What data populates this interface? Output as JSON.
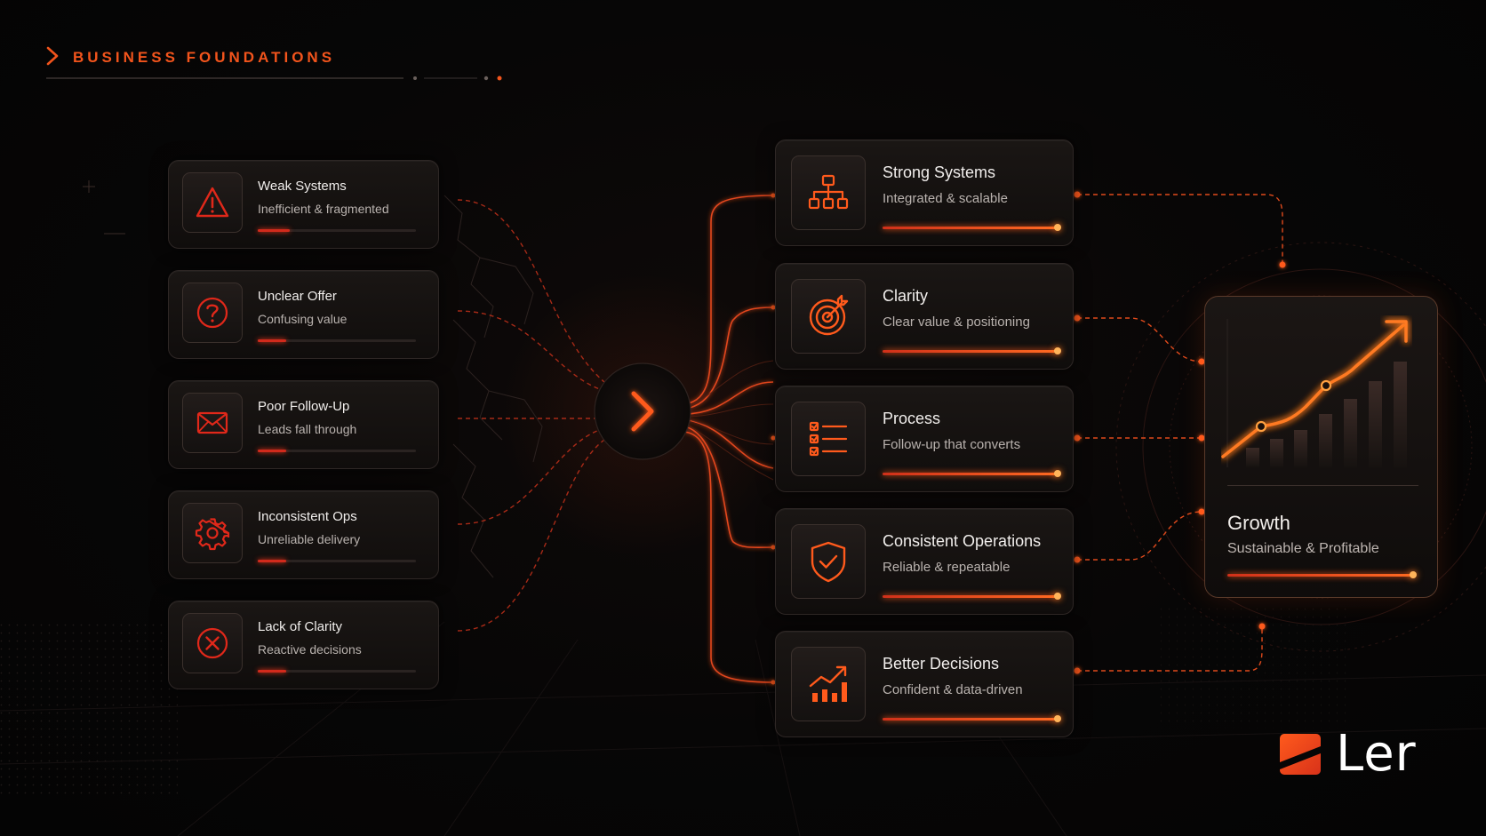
{
  "header": {
    "title": "BUSINESS FOUNDATIONS"
  },
  "problems": [
    {
      "title": "Weak Systems",
      "subtitle": "Inefficient & fragmented",
      "icon": "warning-icon",
      "progress": 0.2
    },
    {
      "title": "Unclear Offer",
      "subtitle": "Confusing value",
      "icon": "question-icon",
      "progress": 0.18
    },
    {
      "title": "Poor Follow-Up",
      "subtitle": "Leads fall through",
      "icon": "envelope-icon",
      "progress": 0.18
    },
    {
      "title": "Inconsistent Ops",
      "subtitle": "Unreliable delivery",
      "icon": "gear-icon",
      "progress": 0.18
    },
    {
      "title": "Lack of Clarity",
      "subtitle": "Reactive decisions",
      "icon": "close-circle-icon",
      "progress": 0.18
    }
  ],
  "solutions": [
    {
      "title": "Strong Systems",
      "subtitle": "Integrated & scalable",
      "icon": "hierarchy-icon",
      "progress": 1.0
    },
    {
      "title": "Clarity",
      "subtitle": "Clear value & positioning",
      "icon": "target-icon",
      "progress": 1.0
    },
    {
      "title": "Process",
      "subtitle": "Follow-up that converts",
      "icon": "checklist-icon",
      "progress": 1.0
    },
    {
      "title": "Consistent Operations",
      "subtitle": "Reliable & repeatable",
      "icon": "shield-check-icon",
      "progress": 1.0
    },
    {
      "title": "Better Decisions",
      "subtitle": "Confident & data-driven",
      "icon": "growth-chart-icon",
      "progress": 1.0
    }
  ],
  "growth": {
    "title": "Growth",
    "subtitle": "Sustainable & Profitable",
    "icon": "growth-trend-icon",
    "progress": 1.0
  },
  "logo": {
    "text": "Ler",
    "icon": "ler-logo-mark"
  },
  "colors": {
    "accent": "#ff5a1c",
    "problem_red": "#d22a1c",
    "background": "#070606",
    "card": "#141110"
  }
}
